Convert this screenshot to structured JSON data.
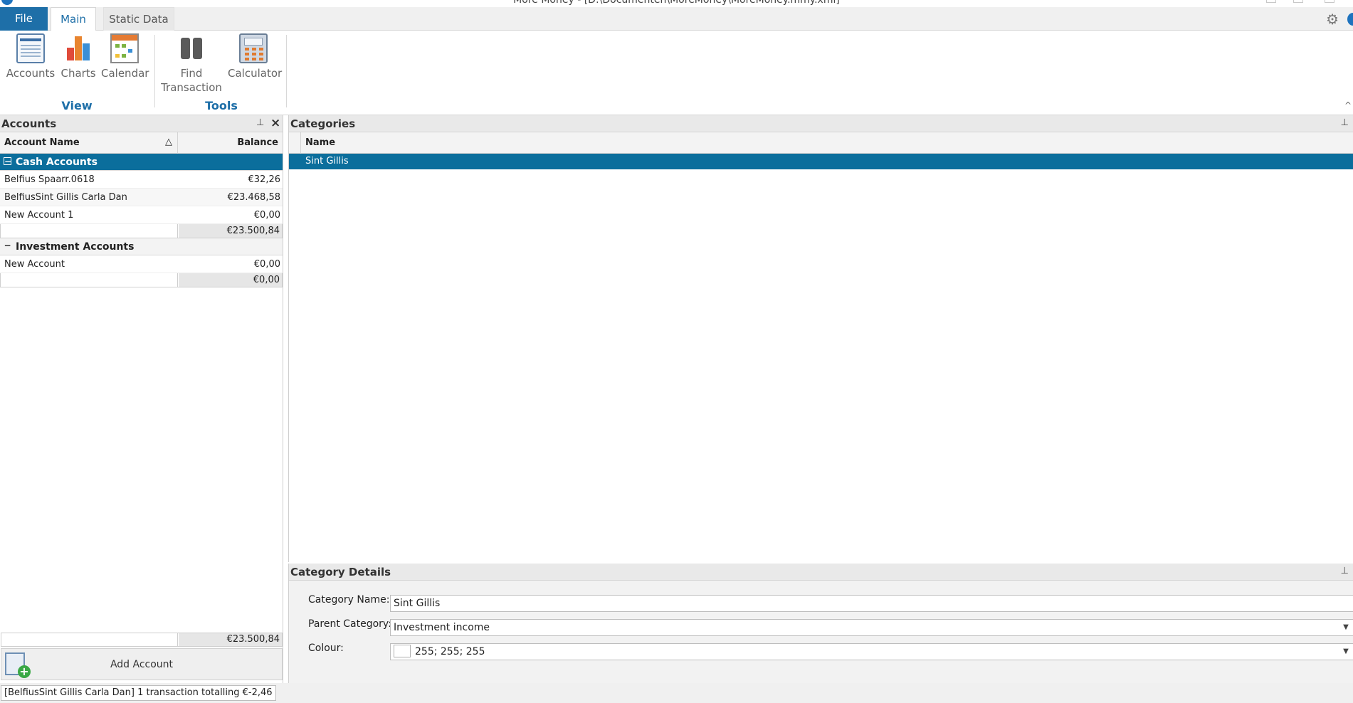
{
  "window": {
    "title": "More Money - [D:\\Documenten\\MoreMoney\\MoreMoney.mmy.xml]"
  },
  "ribbon_tabs": [
    "File",
    "Main",
    "Static Data"
  ],
  "ribbon": {
    "groups": [
      {
        "label": "View",
        "buttons": [
          "Accounts",
          "Charts",
          "Calendar"
        ]
      },
      {
        "label": "Tools",
        "buttons": [
          "Find Transaction",
          "Calculator"
        ]
      }
    ],
    "find_line1": "Find",
    "find_line2": "Transaction"
  },
  "accounts_panel": {
    "title": "Accounts",
    "col_name": "Account Name",
    "col_balance": "Balance",
    "groups": [
      {
        "label": "Cash Accounts",
        "rows": [
          {
            "name": "Belfius Spaarr.0618",
            "balance": "€32,26"
          },
          {
            "name": "BelfiusSint Gillis Carla Dan",
            "balance": "€23.468,58"
          },
          {
            "name": "New Account 1",
            "balance": "€0,00"
          }
        ],
        "subtotal": "€23.500,84"
      },
      {
        "label": "Investment Accounts",
        "rows": [
          {
            "name": "New Account",
            "balance": "€0,00"
          }
        ],
        "subtotal": "€0,00"
      }
    ],
    "total": "€23.500,84",
    "add_button": "Add Account"
  },
  "categories_panel": {
    "title": "Categories",
    "col_name": "Name",
    "rows": [
      "Sint Gillis"
    ]
  },
  "details_panel": {
    "title": "Category Details",
    "name_label": "Category Name:",
    "name_value": "Sint Gillis",
    "parent_label": "Parent Category:",
    "parent_value": "Investment income",
    "colour_label": "Colour:",
    "colour_value": "255; 255; 255"
  },
  "status": {
    "message": "[BelfiusSint Gillis Carla Dan] 1 transaction totalling €-2,46"
  },
  "colors": {
    "accent": "#1e6fa8",
    "selection": "#0b6e9c"
  }
}
